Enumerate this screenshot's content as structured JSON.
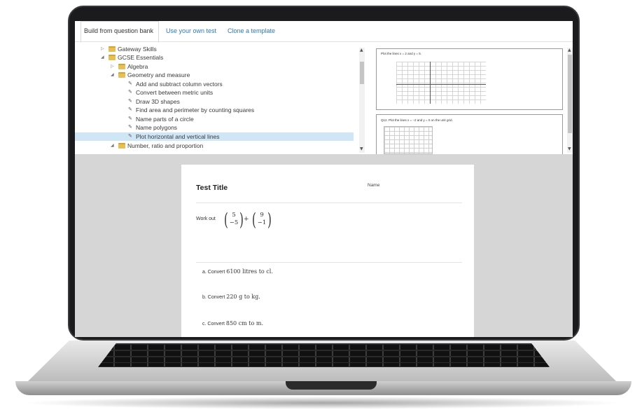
{
  "tabs": [
    {
      "label": "Build from question bank",
      "active": true
    },
    {
      "label": "Use your own test",
      "active": false
    },
    {
      "label": "Clone a template",
      "active": false
    }
  ],
  "tree": [
    {
      "label": "Gateway Skills",
      "kind": "folder",
      "expanded": false
    },
    {
      "label": "GCSE Essentials",
      "kind": "folder",
      "expanded": true
    },
    {
      "label": "Algebra",
      "kind": "folder",
      "expanded": false
    },
    {
      "label": "Geometry and measure",
      "kind": "folder",
      "expanded": true
    },
    {
      "label": "Add and subtract column vectors",
      "kind": "leaf"
    },
    {
      "label": "Convert between metric units",
      "kind": "leaf"
    },
    {
      "label": "Draw 3D shapes",
      "kind": "leaf"
    },
    {
      "label": "Find area and perimeter by counting squares",
      "kind": "leaf"
    },
    {
      "label": "Name parts of a circle",
      "kind": "leaf"
    },
    {
      "label": "Name polygons",
      "kind": "leaf"
    },
    {
      "label": "Plot horizontal and vertical lines",
      "kind": "leaf",
      "selected": true
    },
    {
      "label": "Number, ratio and proportion",
      "kind": "folder",
      "expanded": true
    }
  ],
  "preview": {
    "q1_caption": "Plot the lines x = 2 and y = 5.",
    "q2_caption": "Q12.  Plot the lines x = −2 and y = 0 on the unit grid."
  },
  "document": {
    "title": "Test Title",
    "name_label": "Name",
    "work_out_label": "Work out",
    "vector_a": [
      "5",
      "−5"
    ],
    "vector_b": [
      "9",
      "−1"
    ],
    "plus": "+",
    "parts": [
      {
        "prefix": "a. Convert ",
        "value": "6100 litres",
        "suffix": " to cl."
      },
      {
        "prefix": "b. Convert ",
        "value": "220 g",
        "suffix": " to kg."
      },
      {
        "prefix": "c. Convert ",
        "value": "850 cm",
        "suffix": " to m."
      }
    ]
  },
  "colors": {
    "link": "#2a7ab8",
    "selected_row": "#cfe6f7",
    "folder": "#e7bf55"
  }
}
